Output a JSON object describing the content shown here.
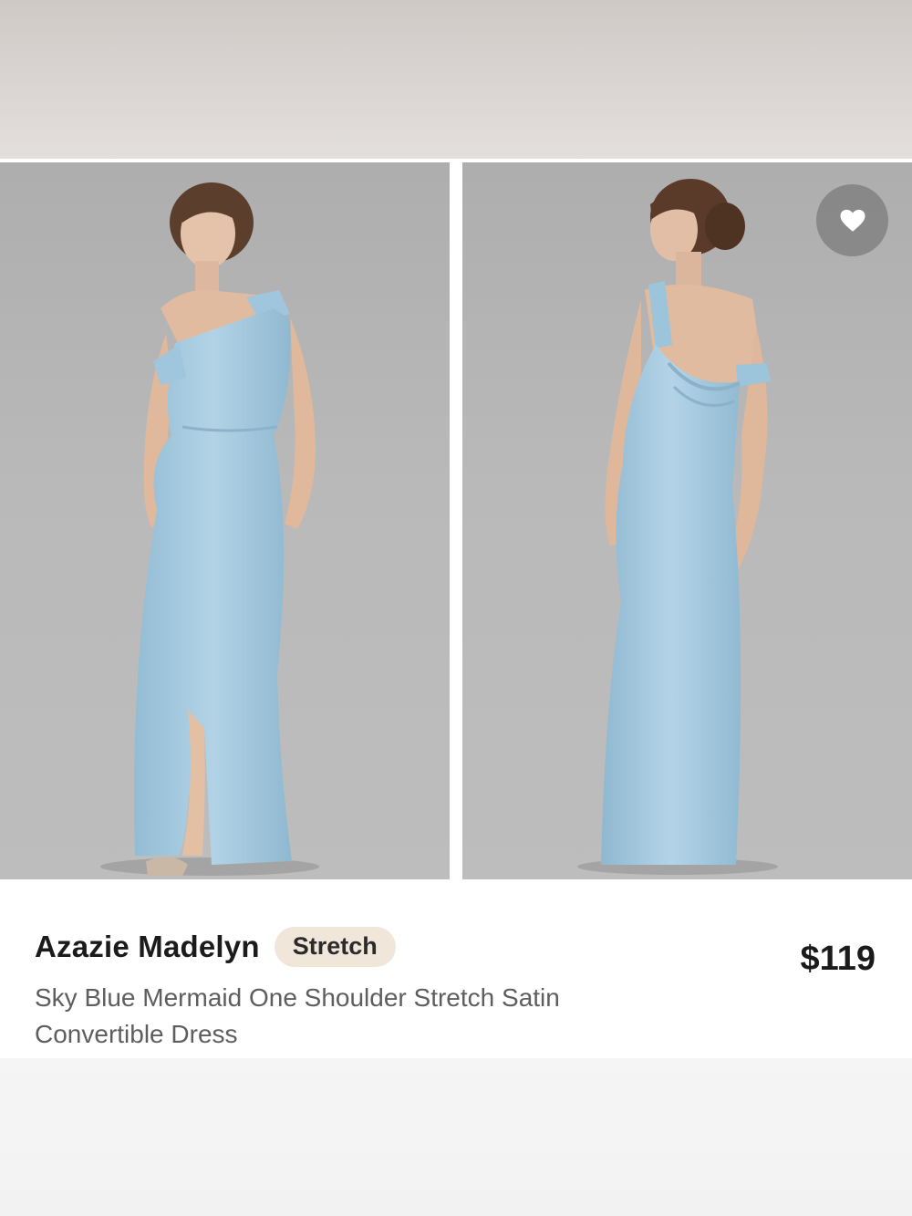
{
  "product": {
    "brand_name": "Azazie Madelyn",
    "badge": "Stretch",
    "price": "$119",
    "description": "Sky Blue Mermaid One Shoulder Stretch Satin Convertible Dress"
  },
  "colors": {
    "dress": "#a6cbe0",
    "background": "#b9b9b9",
    "badge_bg": "#f1e6da"
  },
  "icons": {
    "favorite": "heart-icon"
  }
}
